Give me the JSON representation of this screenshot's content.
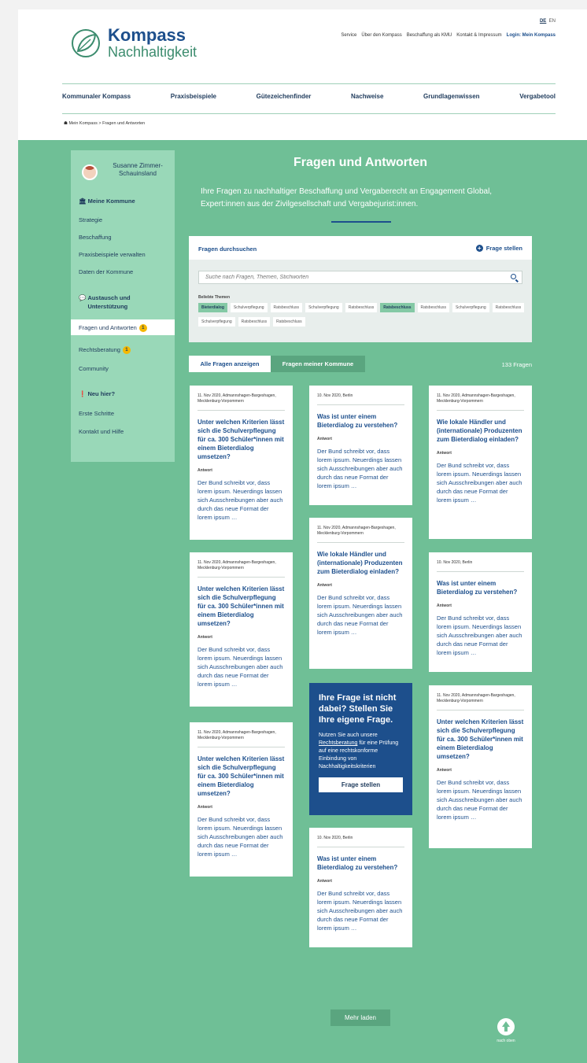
{
  "header": {
    "logo_title": "Kompass",
    "logo_subtitle": "Nachhaltigkeit",
    "lang_de": "DE",
    "lang_en": "EN",
    "service_links": [
      "Service",
      "Über den Kompass",
      "Beschaffung als KMU",
      "Kontakt & Impressum"
    ],
    "login": "Login: Mein Kompass",
    "nav": [
      "Kommunaler Kompass",
      "Praxisbeispiele",
      "Gütezeichenfinder",
      "Nachweise",
      "Grundlagenwissen",
      "Vergabetool"
    ],
    "breadcrumb": "Mein Kompass > Fragen und Antworten"
  },
  "sidebar": {
    "user_name": "Susanne Zimmer-Schauinsland",
    "section1": "Meine Kommune",
    "items1": [
      "Strategie",
      "Beschaffung",
      "Praxisbeispiele verwalten",
      "Daten der Kommune"
    ],
    "section2": "Austausch und Unterstützung",
    "items2": [
      "Fragen und Antworten",
      "Rechtsberatung",
      "Community"
    ],
    "badge_fragen": "1",
    "badge_recht": "1",
    "section3": "Neu hier?",
    "items3": [
      "Erste Schritte",
      "Kontakt und Hilfe"
    ]
  },
  "main": {
    "title": "Fragen und Antworten",
    "intro": "Ihre Fragen zu nachhaltiger Beschaffung und Vergaberecht an Engagement Global, Expert:innen aus der Zivilgesellschaft und Vergabejurist:innen.",
    "search_label": "Fragen durchsuchen",
    "ask_label": "Frage stellen",
    "search_placeholder": "Suche nach Fragen, Themen, Stichworten",
    "themes_label": "Beliebte Themen",
    "tags": [
      "Bieterdialog",
      "Schulverpflegung",
      "Ratsbeschluss",
      "Schulverpflegung",
      "Ratsbeschluss",
      "Ratsbeschluss",
      "Ratsbeschluss",
      "Schulverpflegung",
      "Ratsbeschluss",
      "Schulverpflegung",
      "Ratsbeschluss",
      "Ratsbeschluss"
    ],
    "tab_all": "Alle Fragen anzeigen",
    "tab_mine": "Fragen meiner Kommune",
    "count": "133 Fragen",
    "answer_label": "Antwort",
    "answer_text": "Der Bund schreibt vor, dass lorem ipsum. Neuerdings lassen sich Ausschreibungen aber auch durch das neue Format der lorem ipsum …",
    "cards": [
      {
        "meta": "11. Nov 2020, Admannshagen-Bargeshagen, Mecklenburg-Vorpommern",
        "q": "Unter welchen Kriterien lässt sich die Schulverpflegung für ca. 300 Schüler*innen mit einem Bieterdialog umsetzen?"
      },
      {
        "meta": "10. Nov 2020, Berlin",
        "q": "Was ist unter einem Bieterdialog zu verstehen?"
      },
      {
        "meta": "11. Nov 2020, Admannshagen-Bargeshagen, Mecklenburg-Vorpommern",
        "q": "Wie lokale Händler und (internationale) Produzenten zum Bieterdialog einladen?"
      },
      {
        "meta": "11. Nov 2020, Admannshagen-Bargeshagen, Mecklenburg-Vorpommern",
        "q": "Wie lokale Händler und (internationale) Produzenten zum Bieterdialog einladen?"
      },
      {
        "meta": "10. Nov 2020, Berlin",
        "q": "Was ist unter einem Bieterdialog zu verstehen?"
      },
      {
        "meta": "11. Nov 2020, Admannshagen-Bargeshagen, Mecklenburg-Vorpommern",
        "q": "Unter welchen Kriterien lässt sich die Schulverpflegung für ca. 300 Schüler*innen mit einem Bieterdialog umsetzen?"
      },
      {
        "meta": "11. Nov 2020, Admannshagen-Bargeshagen, Mecklenburg-Vorpommern",
        "q": "Unter welchen Kriterien lässt sich die Schulverpflegung für ca. 300 Schüler*innen mit einem Bieterdialog umsetzen?"
      },
      {
        "meta": "11. Nov 2020, Admannshagen-Bargeshagen, Mecklenburg-Vorpommern",
        "q": "Unter welchen Kriterien lässt sich die Schulverpflegung für ca. 300 Schüler*innen mit einem Bieterdialog umsetzen?"
      },
      {
        "meta": "10. Nov 2020, Berlin",
        "q": "Was ist unter einem Bieterdialog zu verstehen?"
      }
    ],
    "cta": {
      "heading": "Ihre Frage ist nicht dabei? Stellen Sie Ihre eigene Frage.",
      "body_pre": "Nutzen Sie auch unsere ",
      "body_link": "Rechtsberatung",
      "body_post": " für eine Prüfung auf eine rechtskonforme Einbindung von Nachhaltigkeitskriterien",
      "button": "Frage stellen"
    },
    "more": "Mehr laden",
    "to_top": "nach oben"
  },
  "colors": {
    "green": "#6fbf96",
    "sidebar": "#99d8b8",
    "blue": "#1d4f8c",
    "badge": "#f5b800"
  }
}
